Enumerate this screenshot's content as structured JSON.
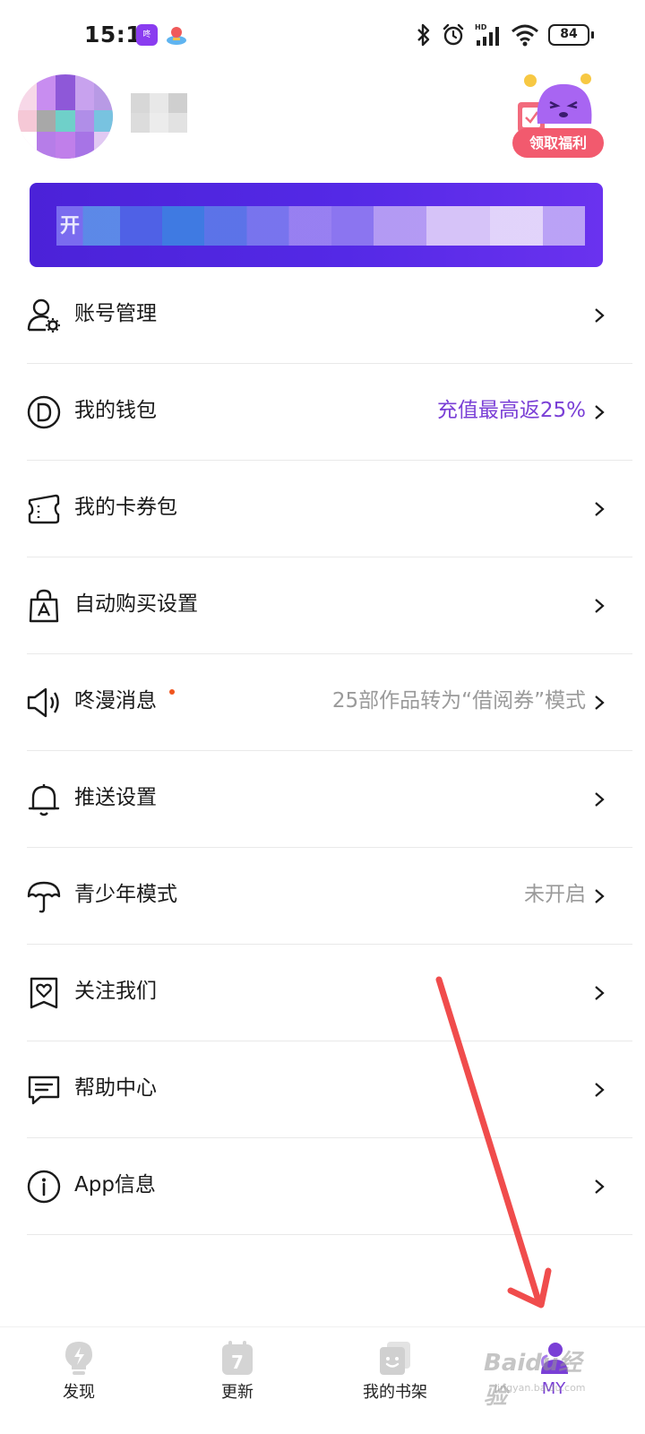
{
  "status_bar": {
    "time": "15:11",
    "app_icon_1": "manga-app-icon",
    "app_icon_2": "space-app-icon",
    "battery": "84",
    "icons": [
      "bluetooth-icon",
      "alarm-icon",
      "signal-hd-icon",
      "wifi-icon",
      "battery-icon"
    ]
  },
  "profile": {
    "avatar_icon": "avatar",
    "welfare_label": "领取福利"
  },
  "menu": {
    "items": [
      {
        "icon": "account-settings-icon",
        "label": "账号管理",
        "value": ""
      },
      {
        "icon": "wallet-icon",
        "label": "我的钱包",
        "value": "充值最高返25%"
      },
      {
        "icon": "coupon-icon",
        "label": "我的卡券包",
        "value": ""
      },
      {
        "icon": "shopping-bag-icon",
        "label": "自动购买设置",
        "value": ""
      },
      {
        "icon": "speaker-icon",
        "label": "咚漫消息",
        "value": "25部作品转为“借阅券”模式"
      },
      {
        "icon": "bell-icon",
        "label": "推送设置",
        "value": ""
      },
      {
        "icon": "umbrella-icon",
        "label": "青少年模式",
        "value": "未开启"
      },
      {
        "icon": "heart-bookmark-icon",
        "label": "关注我们",
        "value": ""
      },
      {
        "icon": "chat-icon",
        "label": "帮助中心",
        "value": ""
      },
      {
        "icon": "info-icon",
        "label": "App信息",
        "value": ""
      }
    ]
  },
  "bottom_nav": {
    "items": [
      {
        "icon": "lightbulb-icon",
        "label": "发现",
        "active": false
      },
      {
        "icon": "calendar-icon",
        "label": "更新",
        "active": false
      },
      {
        "icon": "bookshelf-icon",
        "label": "我的书架",
        "active": false
      },
      {
        "icon": "profile-icon",
        "label": "MY",
        "active": true
      }
    ]
  },
  "calendar_day": "7",
  "watermark": {
    "brand": "Baidu经验",
    "url": "jingyan.baidu.com"
  },
  "colors": {
    "accent": "#7a3fd6",
    "banner": "#4b22d8",
    "welfare": "#f25a6e",
    "annotation_arrow": "#f04c4c"
  }
}
